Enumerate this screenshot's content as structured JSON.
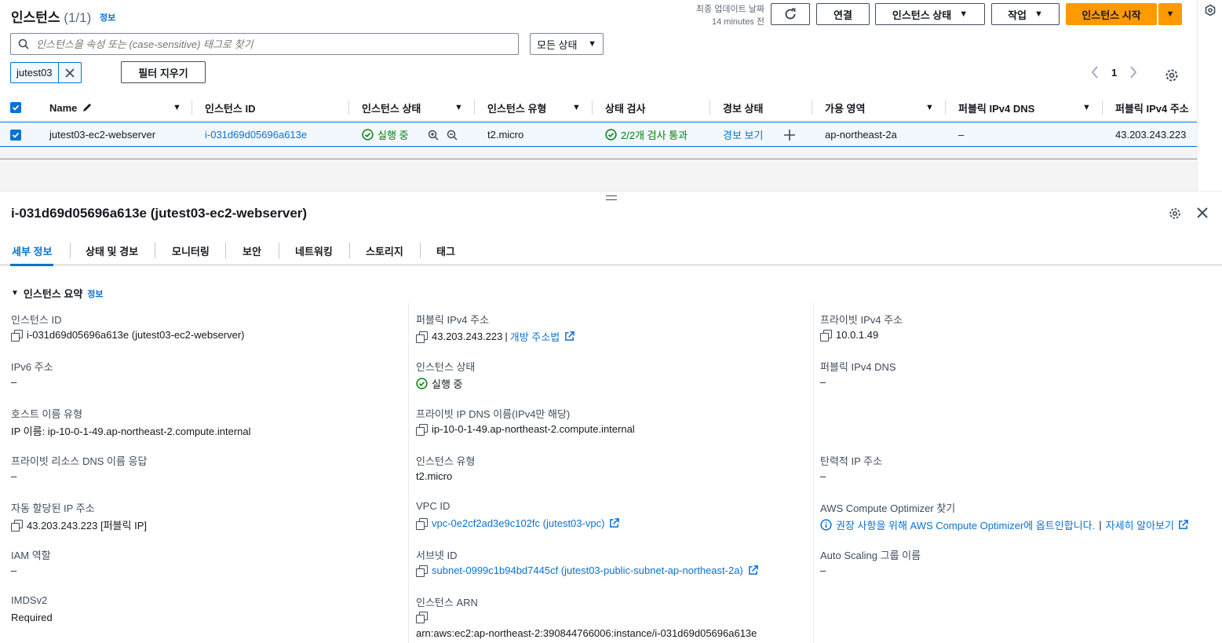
{
  "colors": {
    "accent": "#0972d3",
    "primary": "#ff9900",
    "success": "#037f0c",
    "text": "#16191f"
  },
  "header": {
    "title": "인스턴스",
    "count": "(1/1)",
    "info": "정보",
    "updated_label": "최종 업데이트 날짜",
    "updated_time": "14 minutes 전",
    "refresh_icon": "refresh-icon",
    "connect": "연결",
    "instance_state": "인스턴스 상태",
    "actions": "작업",
    "launch": "인스턴스 시작"
  },
  "filter": {
    "search_placeholder": "인스턴스을 속성 또는 (case-sensitive) 태그로 찾기",
    "status_select": "모든 상태",
    "token": "jutest03",
    "clear": "필터 지우기",
    "page": "1"
  },
  "table": {
    "columns": [
      "Name",
      "인스턴스 ID",
      "인스턴스 상태",
      "인스턴스 유형",
      "상태 검사",
      "경보 상태",
      "가용 영역",
      "퍼블릭 IPv4 DNS",
      "퍼블릭 IPv4 주소"
    ],
    "row": {
      "name": "jutest03-ec2-webserver",
      "instance_id": "i-031d69d05696a613e",
      "state": "실행 중",
      "type": "t2.micro",
      "checks": "2/2개 검사 통과",
      "alarm": "경보 보기",
      "az": "ap-northeast-2a",
      "public_dns": "–",
      "public_ip": "43.203.243.223"
    }
  },
  "detail": {
    "title": "i-031d69d05696a613e (jutest03-ec2-webserver)",
    "tabs": [
      "세부 정보",
      "상태 및 경보",
      "모니터링",
      "보안",
      "네트워킹",
      "스토리지",
      "태그"
    ],
    "summary_title": "인스턴스 요약",
    "summary_info": "정보",
    "col1": {
      "instance_id_k": "인스턴스 ID",
      "instance_id_v": "i-031d69d05696a613e (jutest03-ec2-webserver)",
      "ipv6_k": "IPv6 주소",
      "ipv6_v": "–",
      "hostname_type_k": "호스트 이름 유형",
      "hostname_type_v": "IP 이름: ip-10-0-1-49.ap-northeast-2.compute.internal",
      "private_dns_resp_k": "프라이빗 리소스 DNS 이름 응답",
      "private_dns_resp_v": "–",
      "auto_ip_k": "자동 할당된 IP 주소",
      "auto_ip_v": "43.203.243.223 [퍼블릭 IP]",
      "iam_k": "IAM 역할",
      "iam_v": "–",
      "imds_k": "IMDSv2",
      "imds_v": "Required"
    },
    "col2": {
      "public_ip_k": "퍼블릭 IPv4 주소",
      "public_ip_v": "43.203.243.223",
      "public_ip_sep": "|",
      "open_address": "개방 주소법",
      "state_k": "인스턴스 상태",
      "state_v": "실행 중",
      "private_dns_k": "프라이빗 IP DNS 이름(IPv4만 해당)",
      "private_dns_v": "ip-10-0-1-49.ap-northeast-2.compute.internal",
      "type_k": "인스턴스 유형",
      "type_v": "t2.micro",
      "vpc_k": "VPC ID",
      "vpc_v": "vpc-0e2cf2ad3e9c102fc (jutest03-vpc)",
      "subnet_k": "서브넷 ID",
      "subnet_v": "subnet-0999c1b94bd7445cf (jutest03-public-subnet-ap-northeast-2a)",
      "arn_k": "인스턴스 ARN",
      "arn_v": "arn:aws:ec2:ap-northeast-2:390844766006:instance/i-031d69d05696a613e"
    },
    "col3": {
      "private_ip_k": "프라이빗 IPv4 주소",
      "private_ip_v": "10.0.1.49",
      "public_dns_k": "퍼블릭 IPv4 DNS",
      "public_dns_v": "–",
      "elastic_k": "탄력적 IP 주소",
      "elastic_v": "–",
      "optimizer_k": "AWS Compute Optimizer 찾기",
      "optimizer_v": "권장 사항을 위해 AWS Compute Optimizer에 옵트인합니다.",
      "optimizer_sep": "|",
      "optimizer_more": "자세히 알아보기",
      "asg_k": "Auto Scaling 그룹 이름",
      "asg_v": "–"
    }
  }
}
